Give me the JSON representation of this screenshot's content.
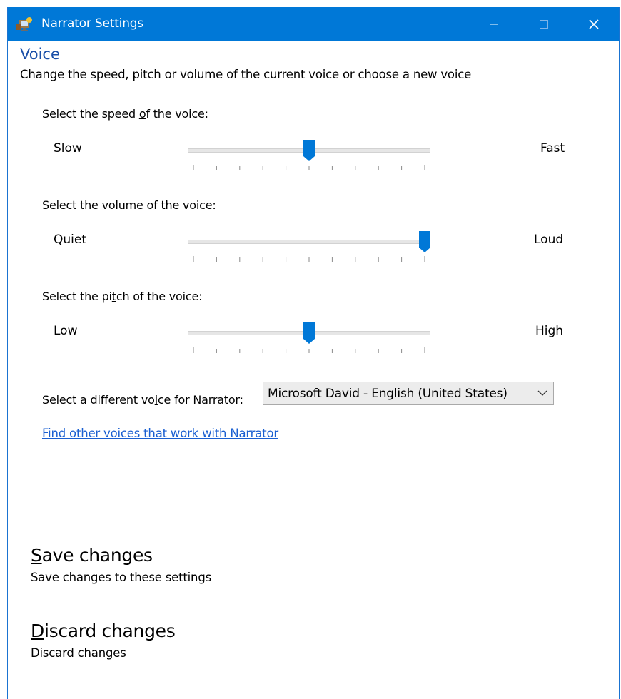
{
  "window": {
    "title": "Narrator Settings"
  },
  "section": {
    "heading": "Voice",
    "subtitle": "Change the speed, pitch or volume of the current voice or choose a new voice"
  },
  "sliders": [
    {
      "label": "Select the speed of the voice:",
      "min_label": "Slow",
      "max_label": "Fast",
      "value": 0.5,
      "ticks": 11
    },
    {
      "label": "Select the volume of the voice:",
      "min_label": "Quiet",
      "max_label": "Loud",
      "value": 1.0,
      "ticks": 11
    },
    {
      "label": "Select the pitch of the voice:",
      "min_label": "Low",
      "max_label": "High",
      "value": 0.5,
      "ticks": 11
    }
  ],
  "voice_select": {
    "label": "Select a different voice for Narrator:",
    "value": "Microsoft David - English (United States)"
  },
  "link": {
    "text": "Find other voices that work with Narrator"
  },
  "commands": {
    "save": {
      "title": "Save changes",
      "desc": "Save changes to these settings"
    },
    "discard": {
      "title": "Discard changes",
      "desc": "Discard changes"
    }
  },
  "colors": {
    "accent": "#0078d7",
    "heading": "#1a4fa8",
    "link": "#1a5fd1"
  }
}
